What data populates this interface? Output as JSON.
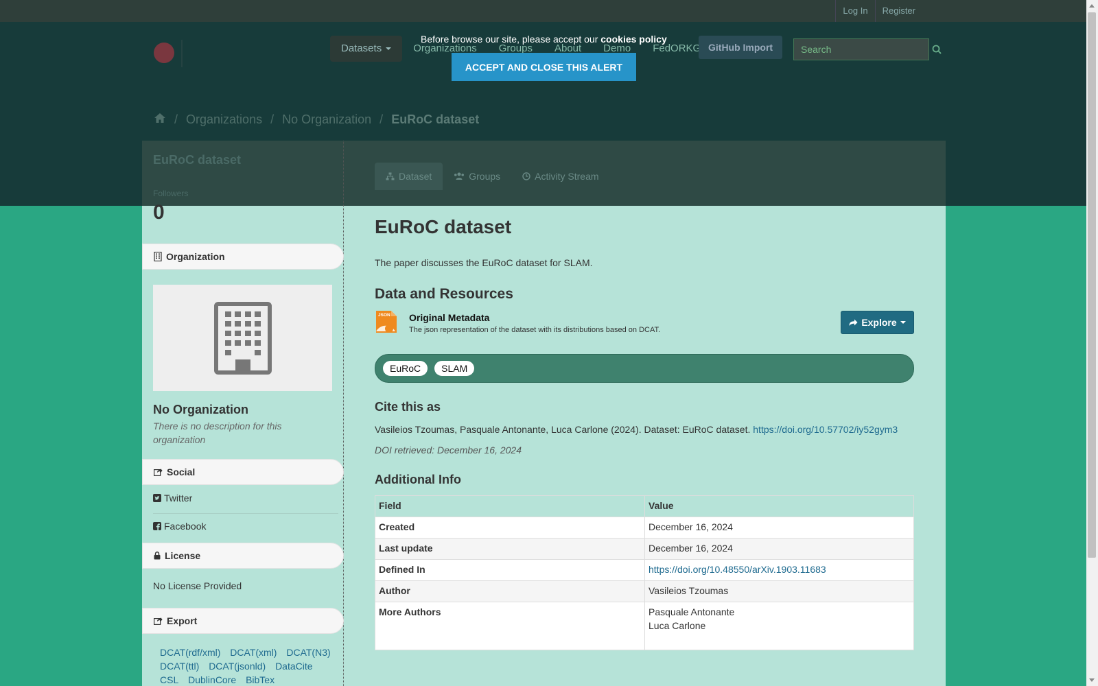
{
  "account": {
    "login": "Log In",
    "register": "Register"
  },
  "nav": {
    "datasets": "Datasets",
    "organizations": "Organizations",
    "groups": "Groups",
    "about": "About",
    "demo": "Demo",
    "fedorkg": "FedORKG",
    "github_import": "GitHub Import"
  },
  "search": {
    "placeholder": "Search"
  },
  "breadcrumb": {
    "organizations": "Organizations",
    "org": "No Organization",
    "current": "EuRoC dataset",
    "sep": "/"
  },
  "cookie": {
    "text_before": "Before browse our site, please accept our",
    "policy": "cookies policy",
    "button": "ACCEPT AND CLOSE THIS ALERT"
  },
  "sidebar": {
    "title": "EuRoC dataset",
    "followers_label": "Followers",
    "followers_count": "0",
    "organization_heading": "Organization",
    "org_name": "No Organization",
    "org_desc": "There is no description for this organization",
    "social_heading": "Social",
    "twitter": "Twitter",
    "facebook": "Facebook",
    "license_heading": "License",
    "license_text": "No License Provided",
    "export_heading": "Export",
    "export_links": [
      "DCAT(rdf/xml)",
      "DCAT(xml)",
      "DCAT(N3)",
      "DCAT(ttl)",
      "DCAT(jsonld)",
      "DataCite",
      "CSL",
      "DublinCore",
      "BibTex"
    ]
  },
  "tabs": {
    "dataset": "Dataset",
    "groups": "Groups",
    "activity": "Activity Stream"
  },
  "main": {
    "title": "EuRoC dataset",
    "notes": "The paper discusses the EuRoC dataset for SLAM.",
    "resources_heading": "Data and Resources",
    "resource_name": "Original Metadata",
    "resource_desc": "The json representation of the dataset with its distributions based on DCAT.",
    "resource_badge": "JSON",
    "explore": "Explore",
    "tags": [
      "EuRoC",
      "SLAM"
    ],
    "cite_heading": "Cite this as",
    "cite_text": "Vasileios Tzoumas, Pasquale Antonante, Luca Carlone (2024). Dataset: EuRoC dataset.",
    "cite_doi": "https://doi.org/10.57702/iy52gym3",
    "doi_retrieved": "DOI retrieved: December 16, 2024",
    "additional_heading": "Additional Info",
    "table_headers": {
      "field": "Field",
      "value": "Value"
    },
    "rows": {
      "created": {
        "field": "Created",
        "value": "December 16, 2024"
      },
      "last_update": {
        "field": "Last update",
        "value": "December 16, 2024"
      },
      "defined_in": {
        "field": "Defined In",
        "value": "https://doi.org/10.48550/arXiv.1903.11683"
      },
      "author": {
        "field": "Author",
        "value": "Vasileios Tzoumas"
      },
      "more_authors": {
        "field": "More Authors",
        "value1": "Pasquale Antonante",
        "value2": "Luca Carlone"
      }
    }
  },
  "colors": {
    "accent": "#2794c9",
    "link": "#1e6a8f",
    "page_bg": "#2aa783",
    "explore_btn": "#206b82"
  }
}
